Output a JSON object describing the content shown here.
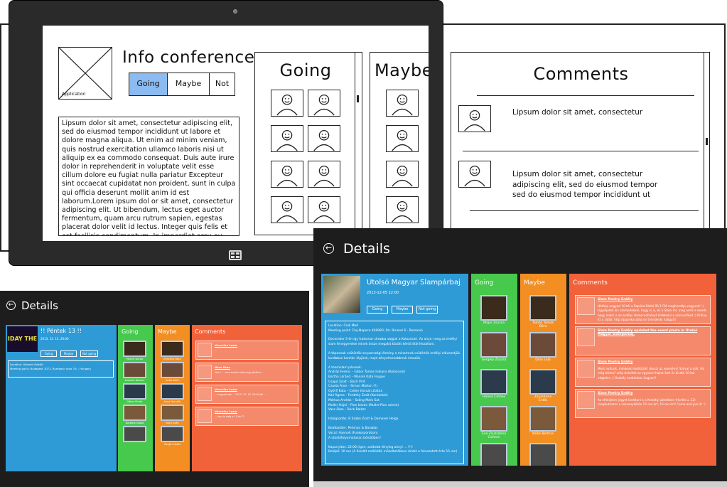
{
  "mockup": {
    "image_caption": "Application",
    "title": "Info conference",
    "segments": [
      "Going",
      "Maybe",
      "Not"
    ],
    "description": "Lipsum dolor sit amet, consectetur adipiscing elit, sed do eiusmod tempor incididunt ut labore et dolore magna aliqua. Ut enim ad minim veniam, quis nostrud exercitation ullamco laboris nisi ut aliquip ex ea commodo consequat. Duis aute irure dolor in reprehenderit in voluptate velit esse cillum dolore eu fugiat nulla pariatur Excepteur sint occaecat cupidatat non proident, sunt in culpa qui officia deserunt mollit anim id est laborum.Lorem ipsum dol or sit amet, consectetur adipiscing elit. Ut bibendum, lectus eget auctor fermentum, quam arcu rutrum sapien, egestas placerat dolor velit id lectus. Integer quis felis et est facilisis condimentum. In imperdiet arcu eu congue mollis. Quisque in fermentum enim. Aenean adipiscing vel",
    "going_title": "Going",
    "maybe_title": "Maybe",
    "comments_title": "Comments",
    "comments": [
      "Lipsum dolor sit amet, consectetur",
      "Lipsum dolor sit amet, consectetur adipiscing elit, sed do eiusmod tempor sed do eiusmod tempor incididunt ut"
    ]
  },
  "small_app": {
    "header_title": "Details",
    "event_name": "!! Péntek 13 !!",
    "event_thumb_text": "IDAY THE 13",
    "event_date": "2013. 12. 13. 20:00",
    "buttons": [
      "Going",
      "Maybe",
      "Not going"
    ],
    "location_line": "Location: Alberta Videóit",
    "meeting_line": "Meeting point: Budapest 1072, Rumbach utca 7/c - Hungary",
    "going_head": "Going",
    "maybe_head": "Maybe",
    "comments_head": "Comments",
    "going_people": [
      "Marcel Kocsis",
      "Levente Kovács",
      "Gábor Pintér",
      "Barbara Szabó",
      ""
    ],
    "maybe_people": [
      "Krisztina Rácz",
      "Anett Kerti",
      "Anna Horváth",
      "Dóra Szép",
      "Gergő Lukács"
    ],
    "comments": [
      {
        "author": "Veronika Lazár",
        "text": "..."
      },
      {
        "author": "Nóra Ákos",
        "text": "Üdv.! ... nem tudom még hogy jövök-e ..."
      },
      {
        "author": "Veronika Lazár",
        "text": "... nagyon sok ... 2013. 12. 13. 20:00-tól ..."
      },
      {
        "author": "Veronika Lazár",
        "text": "... lesz is még a 13-án ??"
      }
    ]
  },
  "large_app": {
    "header_title": "Details",
    "event_name": "Utolsó Magyar Slampárbaj",
    "event_date": "2013-12-05 22:00",
    "buttons": [
      "Going",
      "Maybe",
      "Not going"
    ],
    "location_line": "Location: Club Mod",
    "meeting_line": "Meeting point: Cluj-Napoca 400080, Str. Brnerei 6 - Romania",
    "description_lines": [
      "December 5-én így futásmar showba vágjuk a Kolozsvári. Az anya- meg az erdélyi slam fenegyerekei minek össze megakit között kérdő ötöl lészállani.",
      "",
      "A táposnak csütörtök anyaországi élmény a minamrak csütörtök erdélyi elővezetjük korábban komlán lépjünk, majd kényelmesebbnek érezzük.",
      "",
      "A teamúlam párosok:",
      "András Ferenc – Gábor Tamás Indiana (Kolozsvár)",
      "Bartha Lóránd – Mannik Kata Fruppe",
      "Csapó Zsolt – Bach Pirit",
      "Csosta Áron – Simon Márton (?)",
      "Győrfi Kata – Csider Istvaán Zoltán",
      "Kali Ágnes – Fenthéy Zsolt (Korakolás)",
      "Márkus András – Szőng Márk Sat",
      "Muller Hajni – Pion István (Muller-Pion színek)",
      "Vass Ákos – Rock Balázs",
      "",
      "Házigazdák: B Szabó Zsolt & Domexer Helga",
      "",
      "Beatbattler: Pehman & Barabás",
      "Vocal: Hannah (Funkorporation)",
      "A stúdiófolyamatosan bővülőben!",
      "",
      "Kapunyitás: 22:00 (igen, szűkebb tényleg annyi ... !!!)",
      "Belépő: 10 ron (A Kreditt működőű műkeltetékben direkt a felvezetett érte 15 ron)"
    ],
    "going_head": "Going",
    "maybe_head": "Maybe",
    "comments_head": "Comments",
    "going_people": [
      "Major Zsuzsa",
      "Gergely Zsuzsa",
      "Hanna Cirmes",
      "Éva Zsuzsánna Csőrnei",
      ""
    ],
    "maybe_people": [
      "Tamás Tamás Dóra",
      "Dóra Lala",
      "Zsuzsánna Erdős",
      "Kellie Bertina",
      ""
    ],
    "comments": [
      {
        "author": "Slam Poetry Erdély",
        "text": "Hétfeje negyed 10-től a Paprika Rádió 95.1 FM meghívottja vagyunk! :) Figyeljetek kis szemeitekkel, hogy ki is, és a Slam-ról, meg arról is mesél, hogy miért is az erdélyi slameredményt érdekelni a szervezőket :) Online itt a rádió: http://paprikaradio.ro/ (mindenki hallgat!)"
      },
      {
        "author": "Slam Poetry Erdély updated the event photo in Utolsó Magyar Slampárbaj.",
        "text": ""
      },
      {
        "author": "Slam Poetry Erdély",
        "text": "Most nyitunk, mindenki beöltözik! dosszi az esemény! Szóval a dolt. Ha még biztos? szép beleilett az egyszeri hajnal kell és kiváló 10-kor végtelen :) Osztály mottónkás hogyan?"
      },
      {
        "author": "Slam Poetry Erdély",
        "text": "Az elfelejtem jegyet kiváltani a a Kreditiy üzletében (Horthi u. 22) megbukhatsz a szevenykörön 15 ron-ért, 10 ron-ért! Come and join it! :)"
      }
    ]
  }
}
